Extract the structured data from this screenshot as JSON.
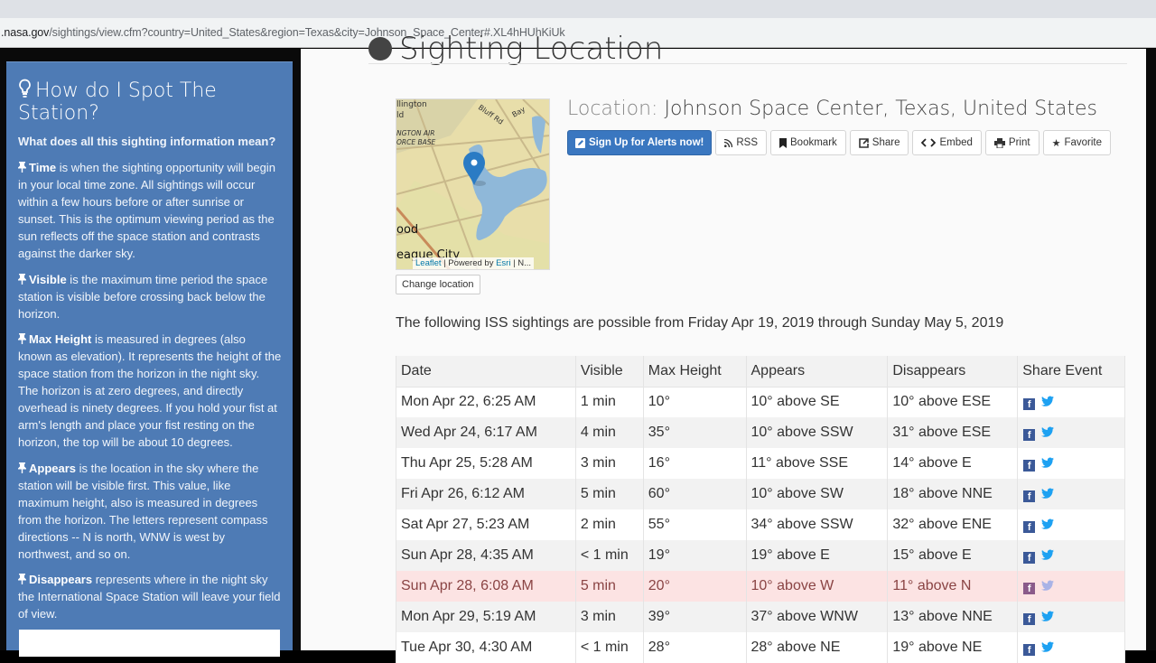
{
  "browser": {
    "url_host": ".nasa.gov",
    "url_path": "/sightings/view.cfm?country=United_States&region=Texas&city=Johnson_Space_Center#.XL4hHUhKiUk"
  },
  "sidebar": {
    "title": "How do I Spot The Station?",
    "subtitle": "What does all this sighting information mean?",
    "paragraphs": [
      {
        "term": "Time",
        "text": " is when the sighting opportunity will begin in your local time zone. All sightings will occur within a few hours before or after sunrise or sunset. This is the optimum viewing period as the sun reflects off the space station and contrasts against the darker sky."
      },
      {
        "term": "Visible",
        "text": " is the maximum time period the space station is visible before crossing back below the horizon."
      },
      {
        "term": "Max Height",
        "text": " is measured in degrees (also known as elevation). It represents the height of the space station from the horizon in the night sky. The horizon is at zero degrees, and directly overhead is ninety degrees. If you hold your fist at arm's length and place your fist resting on the horizon, the top will be about 10 degrees."
      },
      {
        "term": "Appears",
        "text": " is the location in the sky where the station will be visible first. This value, like maximum height, also is measured in degrees from the horizon. The letters represent compass directions -- N is north, WNW is west by northwest, and so on."
      },
      {
        "term": "Disappears",
        "text": " represents where in the night sky the International Space Station will leave your field of view."
      }
    ]
  },
  "main": {
    "heading": "Sighting Location",
    "map": {
      "labels": [
        "llington",
        "ld",
        "NGTON AIR",
        "ORCE BASE",
        "ood",
        "eague City",
        "Bluff Rd",
        "Bay"
      ],
      "attribution_leaflet": "Leaflet",
      "attribution_mid": " | Powered by ",
      "attribution_esri": "Esri",
      "attribution_end": " | N..."
    },
    "change_location_label": "Change location",
    "location_label": "Location:",
    "location_value": "Johnson Space Center, Texas, United States",
    "buttons": {
      "alerts": "Sign Up for Alerts now!",
      "rss": "RSS",
      "bookmark": "Bookmark",
      "share": "Share",
      "embed": "Embed",
      "print": "Print",
      "favorite": "Favorite"
    },
    "range_text": "The following ISS sightings are possible from Friday Apr 19, 2019 through Sunday May 5, 2019",
    "table": {
      "headers": [
        "Date",
        "Visible",
        "Max Height",
        "Appears",
        "Disappears",
        "Share Event"
      ],
      "rows": [
        {
          "date": "Mon Apr 22, 6:25 AM",
          "visible": "1 min",
          "max_height": "10°",
          "appears": "10° above SE",
          "disappears": "10° above ESE",
          "highlighted": false
        },
        {
          "date": "Wed Apr 24, 6:17 AM",
          "visible": "4 min",
          "max_height": "35°",
          "appears": "10° above SSW",
          "disappears": "31° above ESE",
          "highlighted": false
        },
        {
          "date": "Thu Apr 25, 5:28 AM",
          "visible": "3 min",
          "max_height": "16°",
          "appears": "11° above SSE",
          "disappears": "14° above E",
          "highlighted": false
        },
        {
          "date": "Fri Apr 26, 6:12 AM",
          "visible": "5 min",
          "max_height": "60°",
          "appears": "10° above SW",
          "disappears": "18° above NNE",
          "highlighted": false
        },
        {
          "date": "Sat Apr 27, 5:23 AM",
          "visible": "2 min",
          "max_height": "55°",
          "appears": "34° above SSW",
          "disappears": "32° above ENE",
          "highlighted": false
        },
        {
          "date": "Sun Apr 28, 4:35 AM",
          "visible": "< 1 min",
          "max_height": "19°",
          "appears": "19° above E",
          "disappears": "15° above E",
          "highlighted": false
        },
        {
          "date": "Sun Apr 28, 6:08 AM",
          "visible": "5 min",
          "max_height": "20°",
          "appears": "10° above W",
          "disappears": "11° above N",
          "highlighted": true
        },
        {
          "date": "Mon Apr 29, 5:19 AM",
          "visible": "3 min",
          "max_height": "39°",
          "appears": "37° above WNW",
          "disappears": "13° above NNE",
          "highlighted": false
        },
        {
          "date": "Tue Apr 30, 4:30 AM",
          "visible": "< 1 min",
          "max_height": "28°",
          "appears": "28° above NE",
          "disappears": "19° above NE",
          "highlighted": false
        }
      ]
    }
  },
  "icons": {
    "facebook": "f"
  },
  "colors": {
    "sidebar_bg": "#4e7bb5",
    "primary_button": "#3a77c0",
    "highlight_row": "#fce3e3",
    "facebook": "#3b5998",
    "twitter": "#1da1f2"
  }
}
